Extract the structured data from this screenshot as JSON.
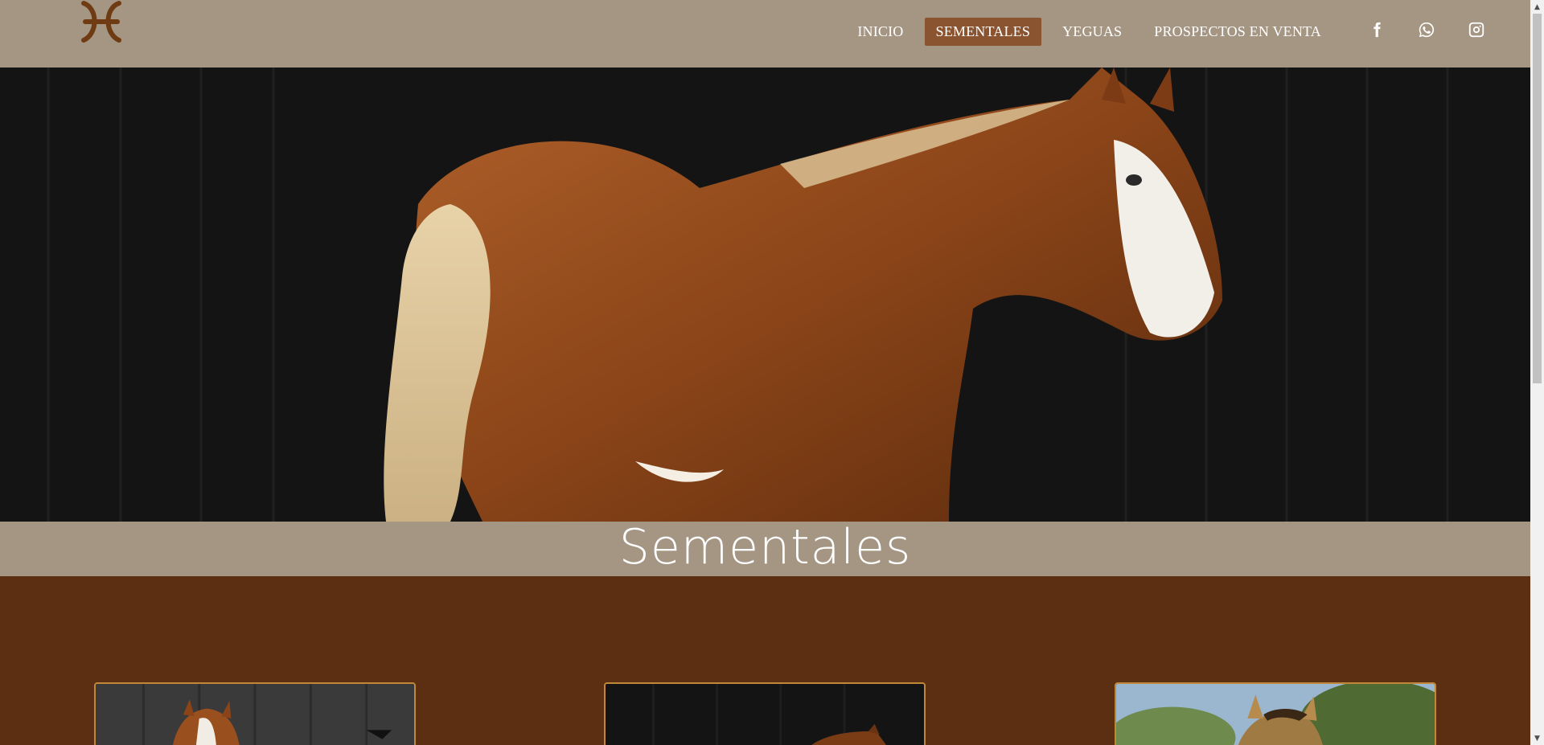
{
  "nav": {
    "items": [
      {
        "label": "INICIO",
        "active": false
      },
      {
        "label": "SEMENTALES",
        "active": true
      },
      {
        "label": "YEGUAS",
        "active": false
      },
      {
        "label": "PROSPECTOS EN VENTA",
        "active": false
      }
    ],
    "social": [
      "facebook-icon",
      "whatsapp-icon",
      "instagram-icon"
    ]
  },
  "page": {
    "title": "Sementales"
  },
  "colors": {
    "header_bg": "#a59684",
    "active_nav_bg": "#8a5430",
    "content_bg": "#5c2f12",
    "card_border": "#c2883a"
  }
}
